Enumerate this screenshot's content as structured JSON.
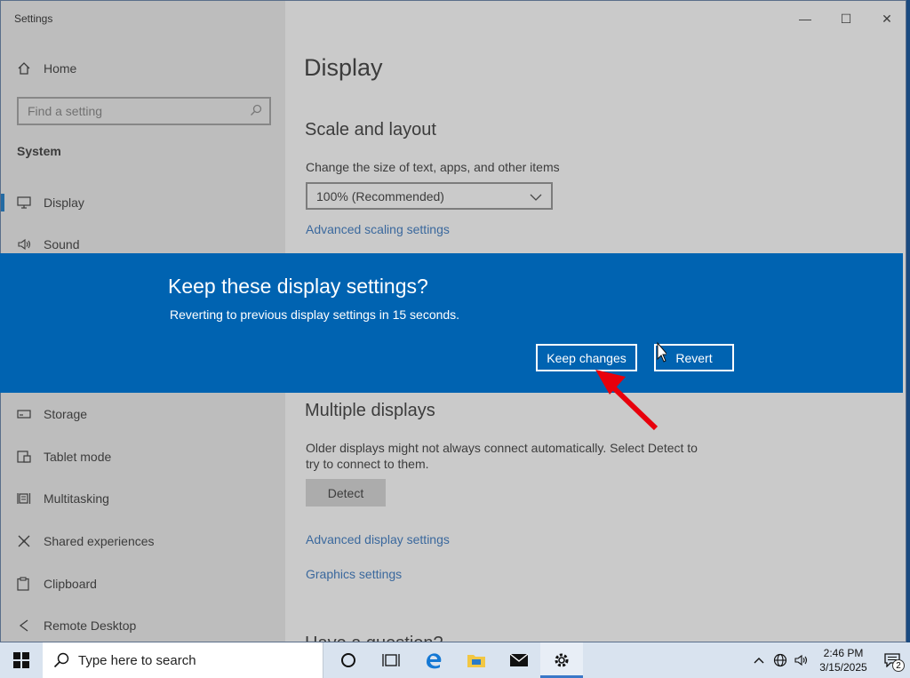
{
  "window": {
    "title": "Settings",
    "controls": {
      "minimize": "—",
      "maximize": "☐",
      "close": "✕"
    }
  },
  "sidebar": {
    "home_label": "Home",
    "search_placeholder": "Find a setting",
    "section_label": "System",
    "items": [
      {
        "label": "Display",
        "icon": "monitor-icon",
        "selected": true
      },
      {
        "label": "Sound",
        "icon": "speaker-icon"
      },
      {
        "label": "Storage",
        "icon": "storage-icon"
      },
      {
        "label": "Tablet mode",
        "icon": "tablet-icon"
      },
      {
        "label": "Multitasking",
        "icon": "multitasking-icon"
      },
      {
        "label": "Shared experiences",
        "icon": "shared-icon"
      },
      {
        "label": "Clipboard",
        "icon": "clipboard-icon"
      },
      {
        "label": "Remote Desktop",
        "icon": "remote-icon"
      }
    ]
  },
  "main": {
    "page_title": "Display",
    "scale_heading": "Scale and layout",
    "scale_desc": "Change the size of text, apps, and other items",
    "scale_value": "100% (Recommended)",
    "advanced_scaling_link": "Advanced scaling settings",
    "multiple_heading": "Multiple displays",
    "multiple_desc_line1": "Older displays might not always connect automatically. Select Detect to",
    "multiple_desc_line2": "try to connect to them.",
    "detect_label": "Detect",
    "advanced_display_link": "Advanced display settings",
    "graphics_link": "Graphics settings",
    "cut_heading": "Have a question?"
  },
  "dialog": {
    "title": "Keep these display settings?",
    "message": "Reverting to previous display settings in 15 seconds.",
    "keep_label": "Keep changes",
    "revert_label": "Revert",
    "color": "#0063b1"
  },
  "taskbar": {
    "search_placeholder": "Type here to search",
    "time": "2:46 PM",
    "date": "3/15/2025",
    "notification_count": "2"
  },
  "colors": {
    "accent": "#0063b1",
    "link": "#1f5fa8",
    "annotation_arrow": "#e8000c"
  }
}
